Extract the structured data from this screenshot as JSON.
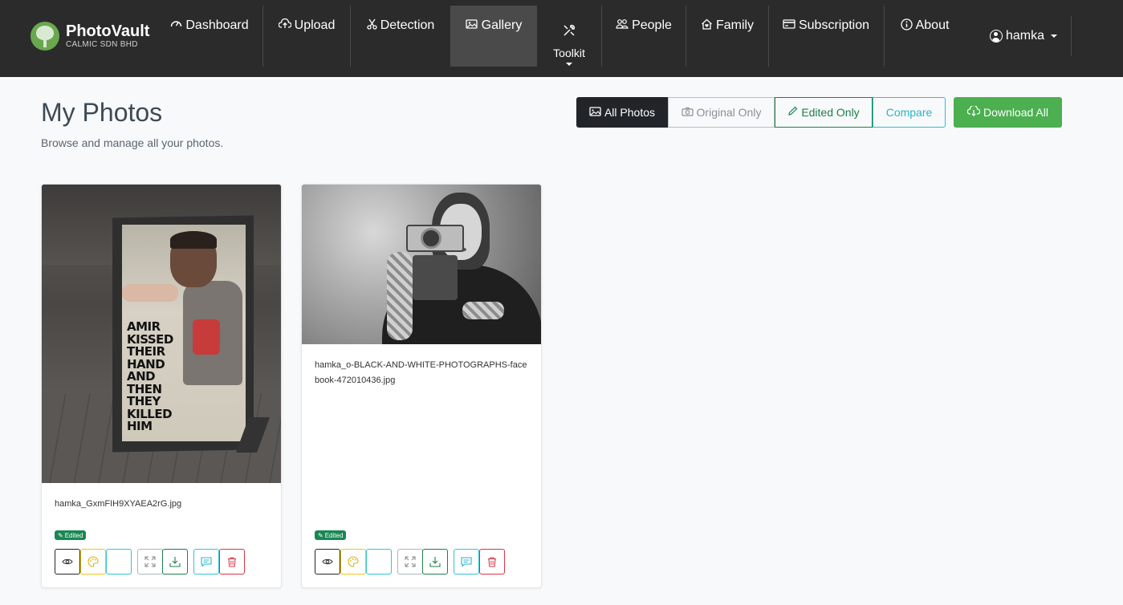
{
  "brand": {
    "name": "PhotoVault",
    "subtitle": "CALMIC SDN BHD",
    "logo_icon": "tree-logo-icon"
  },
  "nav": {
    "items": [
      {
        "label": "Dashboard",
        "icon": "dashboard-gauge-icon"
      },
      {
        "label": "Upload",
        "icon": "cloud-upload-icon"
      },
      {
        "label": "Detection",
        "icon": "scissors-icon"
      },
      {
        "label": "Gallery",
        "icon": "images-icon",
        "active": true
      },
      {
        "label": "Toolkit",
        "icon": "tools-icon"
      },
      {
        "label": "People",
        "icon": "people-icon"
      },
      {
        "label": "Family",
        "icon": "house-heart-icon"
      },
      {
        "label": "Subscription",
        "icon": "credit-card-icon"
      },
      {
        "label": "About",
        "icon": "info-circle-icon"
      }
    ],
    "user": {
      "name": "hamka",
      "icon": "user-circle-icon"
    }
  },
  "header": {
    "title": "My Photos",
    "subtitle": "Browse and manage all your photos."
  },
  "filters": {
    "all": "All Photos",
    "original": "Original Only",
    "edited": "Edited Only",
    "compare": "Compare",
    "active": "all"
  },
  "download_all": "Download All",
  "photos": [
    {
      "filename": "hamka_GxmFIH9XYAEA2rG.jpg",
      "badge": "Edited",
      "image_text": [
        "AMIR",
        "KISSED",
        "THEIR",
        "HAND",
        "AND",
        "THEN",
        "THEY",
        "KILLED",
        "HIM"
      ]
    },
    {
      "filename": "hamka_o-BLACK-AND-WHITE-PHOTOGRAPHS-facebook-472010436.jpg",
      "badge": "Edited"
    }
  ],
  "colors": {
    "navbar": "#2b2b2b",
    "active_nav": "#4a4a4a",
    "download": "#4caf50",
    "edited_badge": "#198754",
    "delete": "#dc3545",
    "info": "#31c4d6",
    "warning": "#f0c419"
  }
}
